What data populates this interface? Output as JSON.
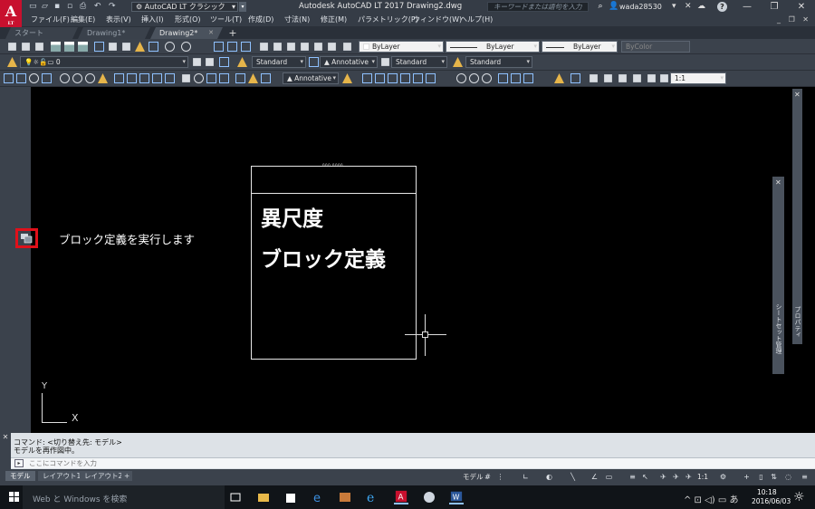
{
  "app": {
    "logo": "A",
    "logo_sub": "LT",
    "workspace": "AutoCAD LT クラシック",
    "title": "Autodesk AutoCAD LT 2017    Drawing2.dwg",
    "search_placeholder": "キーワードまたは語句を入力",
    "user": "wada28530"
  },
  "menu": [
    "ファイル(F)",
    "編集(E)",
    "表示(V)",
    "挿入(I)",
    "形式(O)",
    "ツール(T)",
    "作成(D)",
    "寸法(N)",
    "修正(M)",
    "パラメトリック(P)",
    "ウィンドウ(W)",
    "ヘルプ(H)"
  ],
  "tabs": [
    {
      "label": "スタート",
      "active": false
    },
    {
      "label": "Drawing1*",
      "active": false
    },
    {
      "label": "Drawing2*",
      "active": true
    }
  ],
  "toolbar": {
    "layer_color": "ByLayer",
    "linetype": "ByLayer",
    "lineweight": "ByLayer",
    "plot_style": "ByColor",
    "layer_name": "0",
    "text_style": "Standard",
    "dim_style": "Annotative",
    "table_style": "Standard",
    "mleader_style": "Standard",
    "annotative": "Annotative",
    "scale": "1:1"
  },
  "canvas": {
    "annotation": "ブロック定義を実行します",
    "block_top_label": "000.0000",
    "block_line1": "異尺度",
    "block_line2": "ブロック定義",
    "ucs_x": "X",
    "ucs_y": "Y"
  },
  "palettes": {
    "properties_label": "プロパティ",
    "sheet_label": "シートセット管理"
  },
  "command": {
    "line1": "コマンド:    <切り替え先: モデル>",
    "line2": "モデルを再作図中。",
    "placeholder": "ここにコマンドを入力"
  },
  "layout_tabs": [
    "モデル",
    "レイアウト1",
    "レイアウト2"
  ],
  "status": {
    "model": "モデル",
    "scale": "1:1"
  },
  "taskbar": {
    "search": "Web と Windows を検索",
    "time": "10:18",
    "date": "2016/06/03",
    "ime": "あ"
  },
  "colors": {
    "accent_red": "#e0101a",
    "autocad_red": "#c8102e",
    "canvas_bg": "#000000",
    "panel_bg": "#3b424c"
  }
}
